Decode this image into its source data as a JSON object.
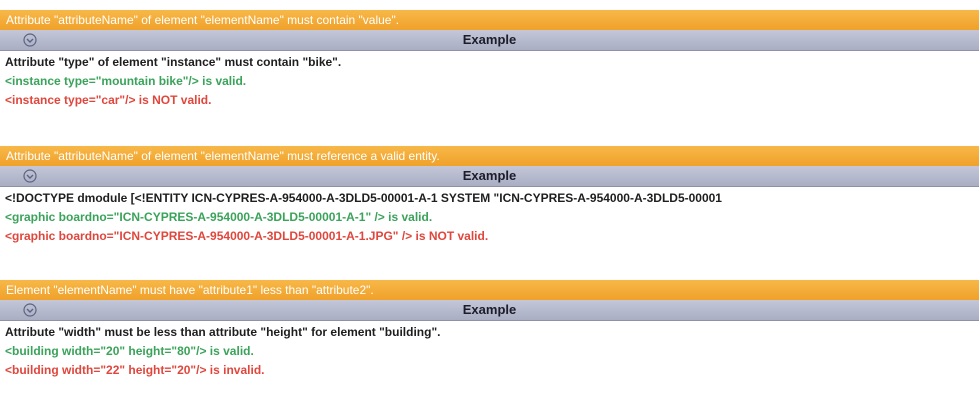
{
  "colors": {
    "title_bar": "#f0a12a",
    "example_bar": "#b4b9cc",
    "valid": "#3aa35a",
    "invalid": "#e0463c",
    "description": "#1e1e1e"
  },
  "rules": [
    {
      "title": "Attribute \"attributeName\" of element \"elementName\" must contain \"value\".",
      "example_label": "Example",
      "toggle_icon": "chevron-down-circle-icon",
      "lines": [
        {
          "text": "Attribute \"type\" of element \"instance\" must contain \"bike\".",
          "kind": "description"
        },
        {
          "text": "<instance type=\"mountain bike\"/> is valid.",
          "kind": "valid"
        },
        {
          "text": "<instance type=\"car\"/> is NOT valid.",
          "kind": "invalid"
        }
      ]
    },
    {
      "title": "Attribute \"attributeName\" of element \"elementName\" must reference a valid entity.",
      "example_label": "Example",
      "toggle_icon": "chevron-down-circle-icon",
      "lines": [
        {
          "text": "<!DOCTYPE dmodule [<!ENTITY ICN-CYPRES-A-954000-A-3DLD5-00001-A-1 SYSTEM \"ICN-CYPRES-A-954000-A-3DLD5-00001",
          "kind": "description"
        },
        {
          "text": "<graphic boardno=\"ICN-CYPRES-A-954000-A-3DLD5-00001-A-1\" /> is valid.",
          "kind": "valid"
        },
        {
          "text": "<graphic boardno=\"ICN-CYPRES-A-954000-A-3DLD5-00001-A-1.JPG\" /> is NOT valid.",
          "kind": "invalid"
        }
      ]
    },
    {
      "title": "Element \"elementName\" must have \"attribute1\" less than \"attribute2\".",
      "example_label": "Example",
      "toggle_icon": "chevron-down-circle-icon",
      "lines": [
        {
          "text": "Attribute \"width\" must be less than attribute \"height\" for element \"building\".",
          "kind": "description"
        },
        {
          "text": "<building width=\"20\" height=\"80\"/> is valid.",
          "kind": "valid"
        },
        {
          "text": "<building width=\"22\" height=\"20\"/> is invalid.",
          "kind": "invalid"
        }
      ]
    }
  ]
}
